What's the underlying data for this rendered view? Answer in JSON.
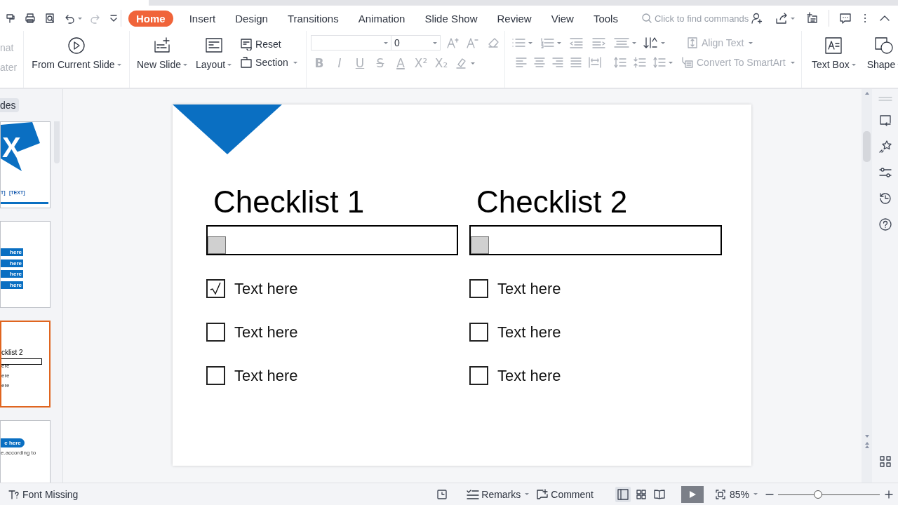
{
  "tabs": [
    {
      "label": "Home",
      "selected": true
    },
    {
      "label": "Insert",
      "selected": false
    },
    {
      "label": "Design",
      "selected": false
    },
    {
      "label": "Transitions",
      "selected": false
    },
    {
      "label": "Animation",
      "selected": false
    },
    {
      "label": "Slide Show",
      "selected": false
    },
    {
      "label": "Review",
      "selected": false
    },
    {
      "label": "View",
      "selected": false
    },
    {
      "label": "Tools",
      "selected": false
    }
  ],
  "search": {
    "placeholder": "Click to find commands"
  },
  "ribbon": {
    "format_painter": {
      "lines": [
        "nat",
        "ater"
      ],
      "disabled": true
    },
    "from_current_slide": {
      "label": "From Current Slide"
    },
    "new_slide": {
      "label": "New Slide"
    },
    "layout": {
      "label": "Layout"
    },
    "reset": {
      "label": "Reset"
    },
    "section": {
      "label": "Section"
    },
    "font_size": {
      "value": "0"
    },
    "format_buttons": [
      {
        "kind": "bold",
        "label": "B",
        "disabled": true
      },
      {
        "kind": "italic",
        "label": "I",
        "disabled": true
      },
      {
        "kind": "underline",
        "label": "U",
        "disabled": true
      },
      {
        "kind": "strike",
        "label": "S",
        "disabled": true
      },
      {
        "kind": "font_color",
        "label": "A",
        "disabled": true
      },
      {
        "kind": "superscript",
        "label": "X²",
        "disabled": true
      },
      {
        "kind": "subscript",
        "label": "X₂",
        "disabled": true
      }
    ],
    "align_text": {
      "label": "Align Text",
      "disabled": true
    },
    "convert_smartart": {
      "label": "Convert To SmartArt",
      "disabled": true
    },
    "text_box": {
      "label": "Text Box"
    },
    "shape": {
      "label": "Shape"
    }
  },
  "slides_panel": {
    "tab_label": "des",
    "thumbnails": [
      {
        "kind": "title",
        "selected": false,
        "texts": [
          "X",
          "T]",
          "[TEXT]"
        ]
      },
      {
        "kind": "bars",
        "selected": false,
        "texts": [
          "here",
          "here",
          "here",
          "here"
        ]
      },
      {
        "kind": "checklist",
        "selected": true,
        "texts": [
          "cklist 2",
          "ere",
          "ere",
          "ere"
        ]
      },
      {
        "kind": "pill",
        "selected": false,
        "texts": [
          "e here",
          "e.according to"
        ]
      }
    ]
  },
  "slide": {
    "checklists": [
      {
        "title": "Checklist 1",
        "items": [
          {
            "label": "Text here",
            "checked": true
          },
          {
            "label": "Text here",
            "checked": false
          },
          {
            "label": "Text here",
            "checked": false
          }
        ]
      },
      {
        "title": "Checklist 2",
        "items": [
          {
            "label": "Text here",
            "checked": false
          },
          {
            "label": "Text here",
            "checked": false
          },
          {
            "label": "Text here",
            "checked": false
          }
        ]
      }
    ]
  },
  "status_bar": {
    "font_missing": "Font Missing",
    "remarks": "Remarks",
    "comment": "Comment",
    "views": [
      {
        "kind": "normal",
        "selected": true
      },
      {
        "kind": "sorter",
        "selected": false
      },
      {
        "kind": "reading",
        "selected": false
      }
    ],
    "zoom": "85%",
    "zoom_slider": {
      "level": 0.39
    }
  }
}
